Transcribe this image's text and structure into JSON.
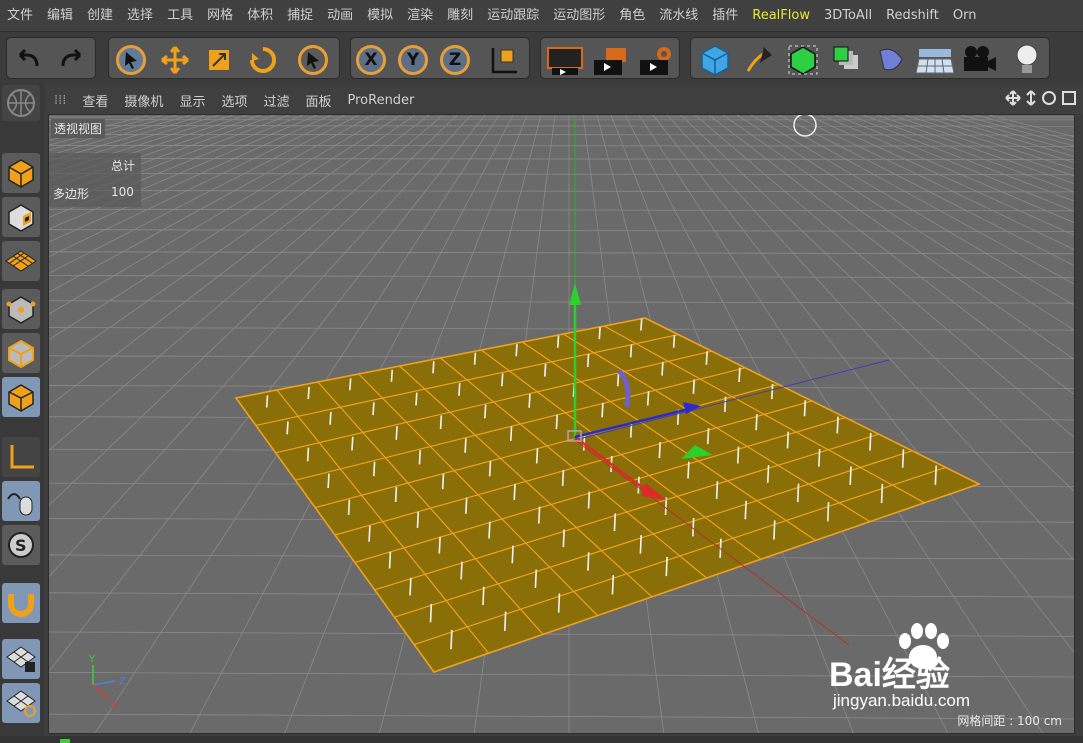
{
  "menubar": {
    "items": [
      "文件",
      "编辑",
      "创建",
      "选择",
      "工具",
      "网格",
      "体积",
      "捕捉",
      "动画",
      "模拟",
      "渲染",
      "雕刻",
      "运动跟踪",
      "运动图形",
      "角色",
      "流水线",
      "插件",
      "RealFlow",
      "3DToAll",
      "Redshift",
      "Orn"
    ],
    "highlight_index": 17,
    "highlight_color": "#e8e832"
  },
  "toolbar": {
    "undo": "undo-icon",
    "redo": "redo-icon",
    "tools": [
      "select-arrow-icon",
      "move-icon",
      "scale-icon",
      "rotate-icon",
      "live-select-icon"
    ],
    "axes": [
      "X",
      "Y",
      "Z"
    ],
    "coord_system": "coordinate-system-icon",
    "render": [
      "render-view-icon",
      "render-picture-queue-icon",
      "render-settings-icon"
    ],
    "objects": [
      "cube-icon",
      "pen-spline-icon",
      "subdivision-icon",
      "cloner-icon",
      "deformer-icon",
      "floor-icon",
      "camera-icon",
      "light-icon"
    ]
  },
  "left_toolbar": [
    "make-editable-icon",
    "texture-mode-icon",
    "workplane-icon",
    "points-mode-icon",
    "edges-mode-icon",
    "polygons-mode-icon",
    "axis-icon",
    "tweak-mode-icon",
    "snap-icon",
    "magnet-icon",
    "lock-grid-icon",
    "solo-icon"
  ],
  "viewport": {
    "menu": [
      "查看",
      "摄像机",
      "显示",
      "选项",
      "过滤",
      "面板",
      "ProRender"
    ],
    "name": "透视视图",
    "stats_header": "总计",
    "stats_label": "多边形",
    "stats_value": "100",
    "grid_spacing": "网格间距 : 100 cm",
    "axis_labels": [
      "Y",
      "Z",
      "X"
    ],
    "plane_color": "#8a6e08",
    "edge_color": "#f0a11c",
    "grid_color": "#8a8a8a"
  },
  "watermark": {
    "text_top": "Bai经验",
    "url": "jingyan.baidu.com"
  }
}
